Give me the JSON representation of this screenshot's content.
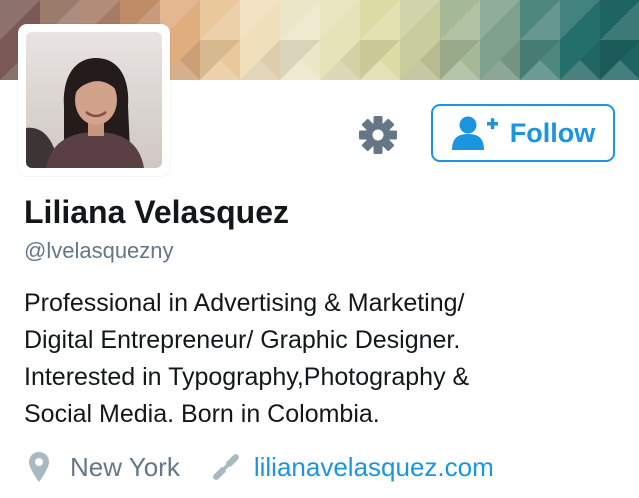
{
  "profile": {
    "name": "Liliana Velasquez",
    "handle": "@lvelasquezny",
    "bio_lines": [
      "Professional in Advertising & Marketing/",
      "Digital Entrepreneur/ Graphic Designer.",
      "Interested in Typography,Photography &",
      "Social Media. Born in Colombia."
    ],
    "location": "New York",
    "website": "lilianavelasquez.com"
  },
  "actions": {
    "follow_label": "Follow",
    "settings_icon": "gear-icon",
    "follow_icon": "add-user-icon"
  },
  "colors": {
    "accent": "#1b95e0",
    "secondary_text": "#657786",
    "primary_text": "#14171a"
  }
}
